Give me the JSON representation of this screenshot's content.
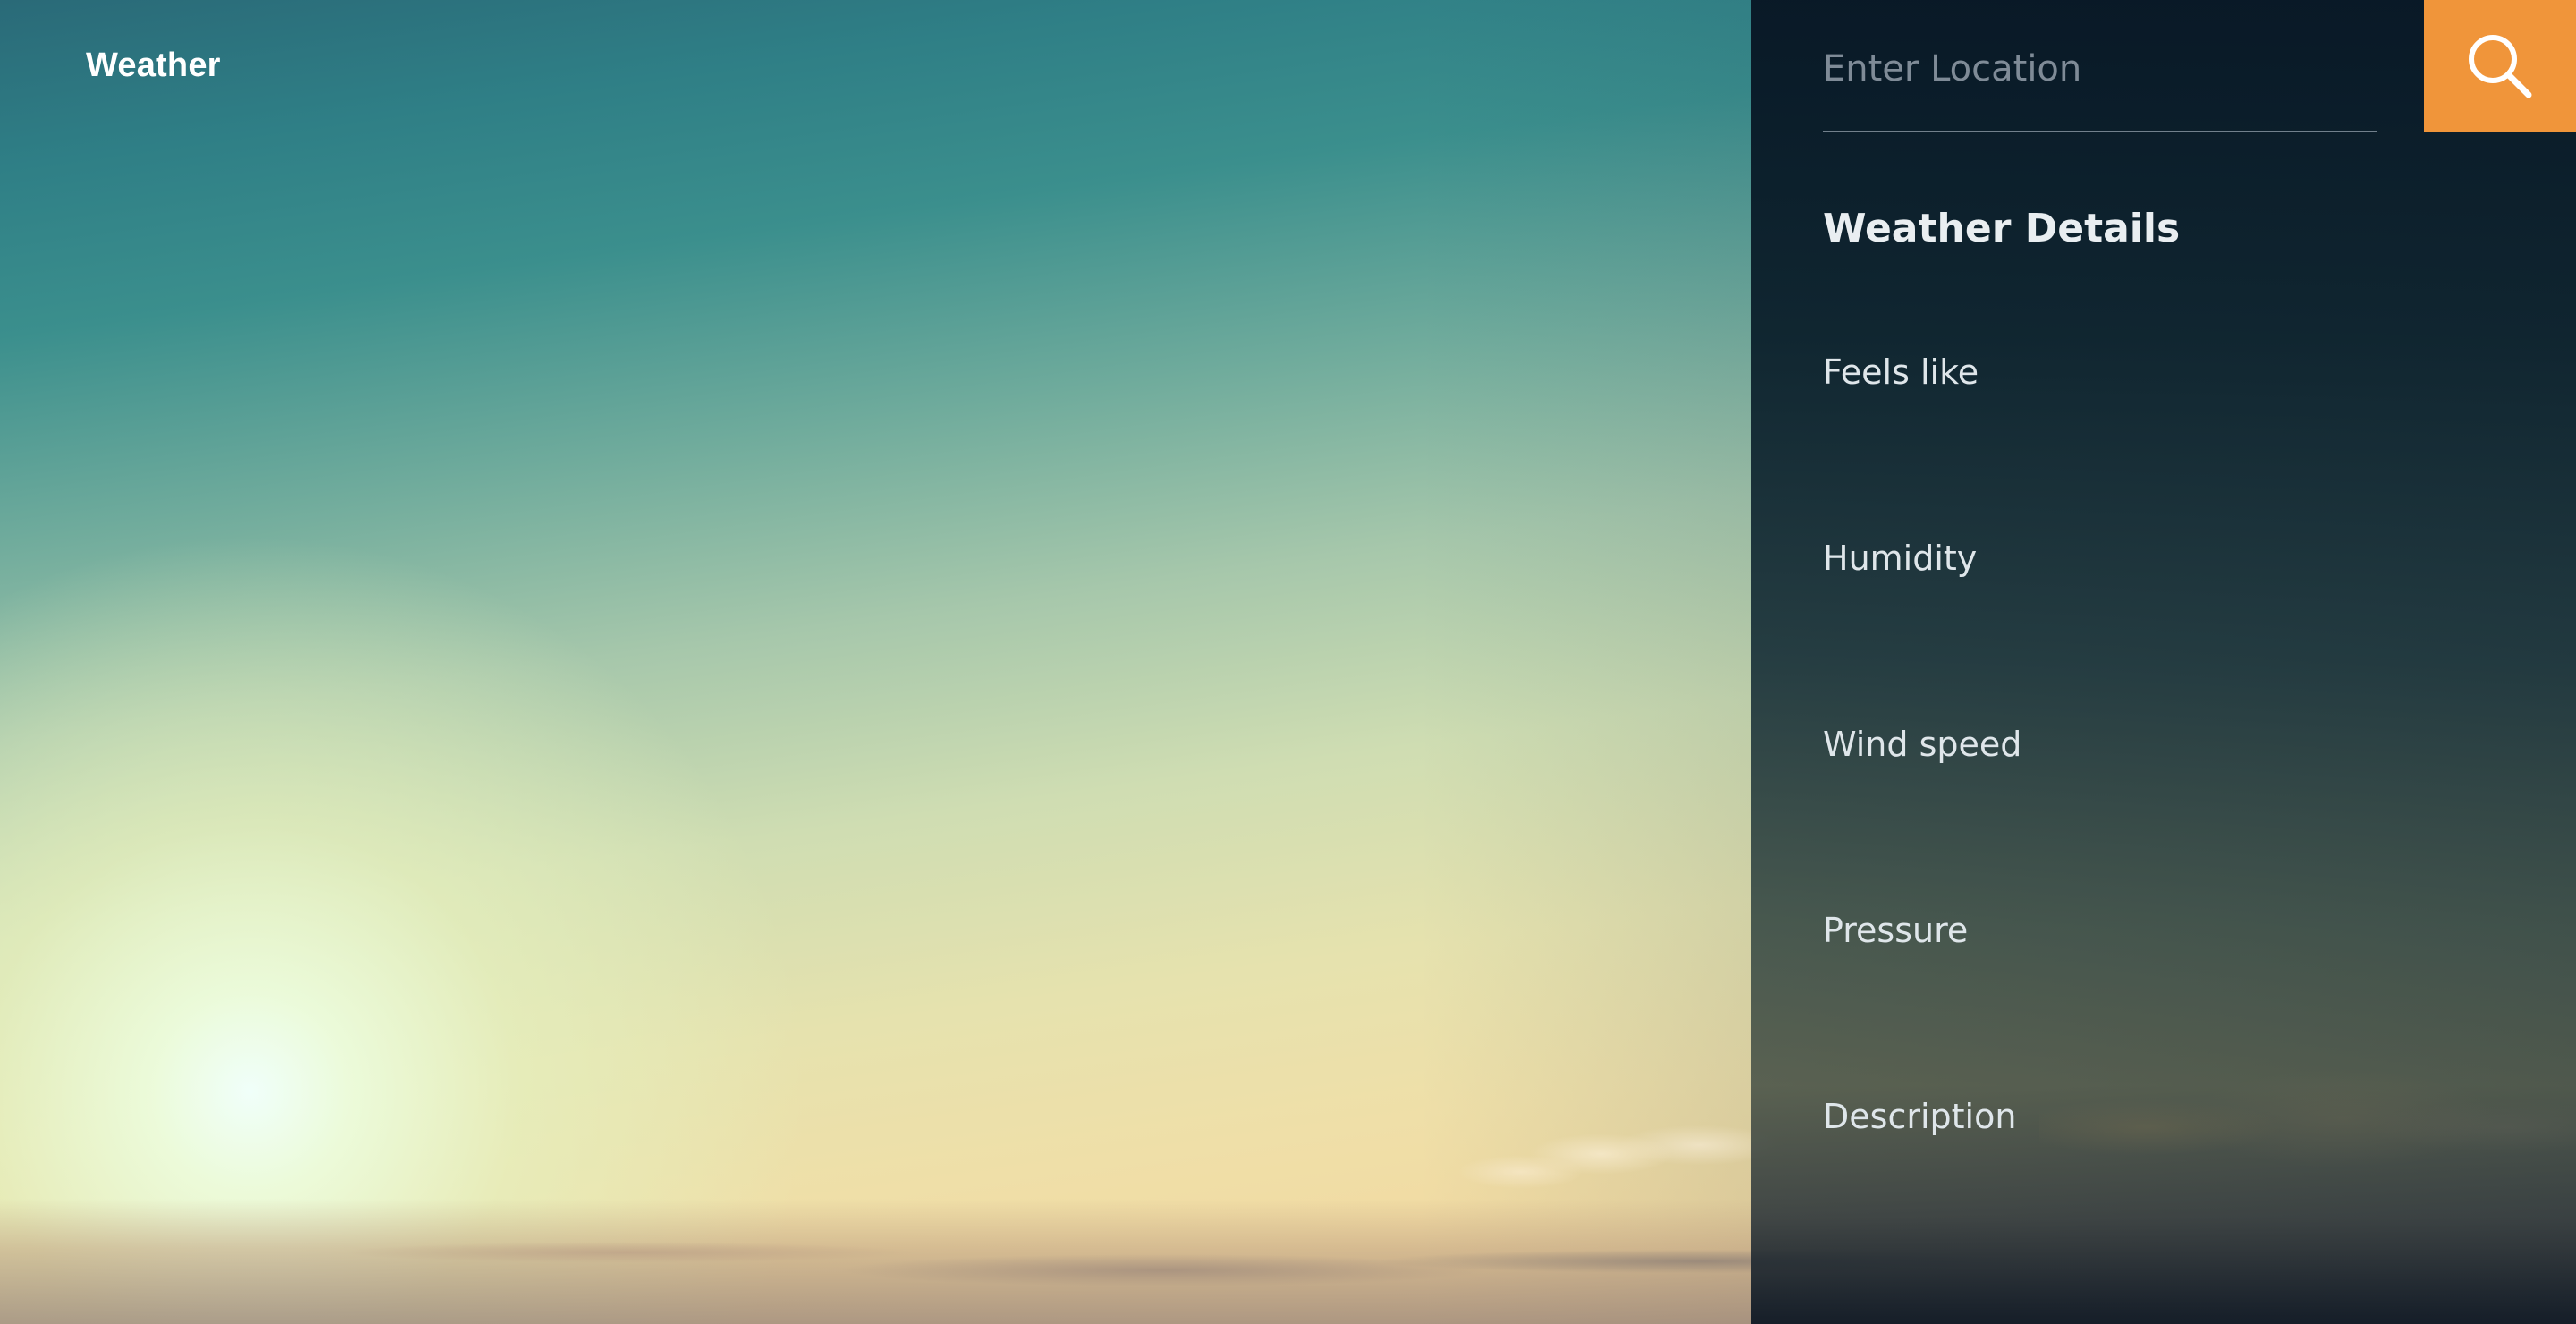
{
  "app": {
    "title": "Weather"
  },
  "search": {
    "placeholder": "Enter Location",
    "value": ""
  },
  "details": {
    "title": "Weather Details",
    "rows": [
      {
        "label": "Feels like",
        "value": ""
      },
      {
        "label": "Humidity",
        "value": ""
      },
      {
        "label": "Wind speed",
        "value": ""
      },
      {
        "label": "Pressure",
        "value": ""
      },
      {
        "label": "Description",
        "value": ""
      }
    ]
  },
  "colors": {
    "accent": "#f0953a",
    "panel": "#0b1a26",
    "text": "#e9eef1"
  },
  "icons": {
    "search": "search-icon"
  }
}
